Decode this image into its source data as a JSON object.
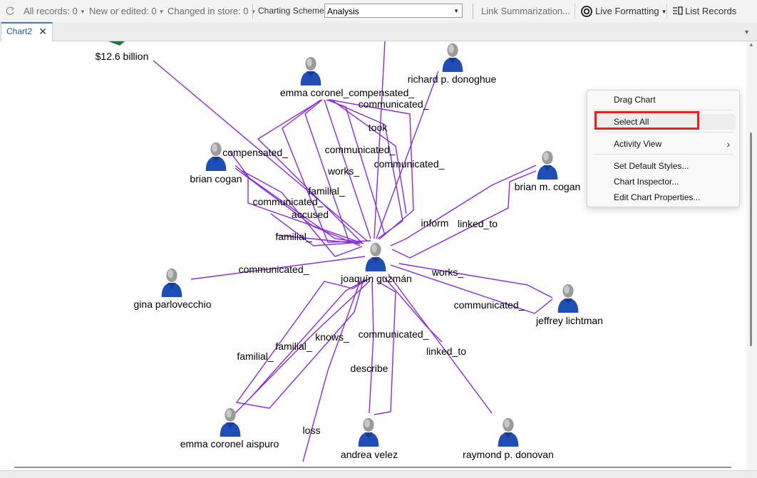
{
  "toolbar": {
    "all_records": "All records: 0",
    "new_or_edited": "New or edited: 0",
    "changed_in_store": "Changed in store: 0",
    "charting_scheme_label": "Charting Scheme:",
    "charting_scheme_value": "Analysis",
    "link_summarization": "Link Summarization...",
    "live_formatting": "Live Formatting",
    "list_records": "List Records"
  },
  "tabs": [
    {
      "label": "Chart2"
    }
  ],
  "chart": {
    "nodes": {
      "n0": "$12.6 billion",
      "n1": "emma coronel_compensated_",
      "n2": "richard p. donoghue",
      "n3": "brian cogan",
      "n4": "brian m. cogan",
      "n5": "joaquín guzmán",
      "n6": "gina parlovecchio",
      "n7": "jeffrey lichtman",
      "n8": "emma coronel aispuro",
      "n9": "andrea velez",
      "n10": "raymond p. donovan"
    },
    "links": {
      "l0": "communicated_",
      "l1": "took",
      "l2": "compensated_",
      "l3": "communicated_",
      "l4": "communicated_",
      "l5": "works_",
      "l6": "familial_",
      "l7": "communicated_",
      "l8": "accused",
      "l9": "inform",
      "l10": "linked_to",
      "l11": "familial_",
      "l12": "communicated_",
      "l13": "works_",
      "l14": "communicated_",
      "l15": "knows_",
      "l16": "communicated_",
      "l17": "familial_",
      "l18": "familial_",
      "l19": "linked_to",
      "l20": "describe",
      "l21": "loss"
    }
  },
  "context_menu": {
    "drag_chart": "Drag Chart",
    "select_all": "Select All",
    "activity_view": "Activity View",
    "set_default_styles": "Set Default Styles...",
    "chart_inspector": "Chart Inspector...",
    "edit_chart_properties": "Edit Chart Properties..."
  },
  "colors": {
    "link_line": "#8a2be2",
    "person_icon": "#1f4fb6",
    "highlight_box": "#e8201f"
  }
}
